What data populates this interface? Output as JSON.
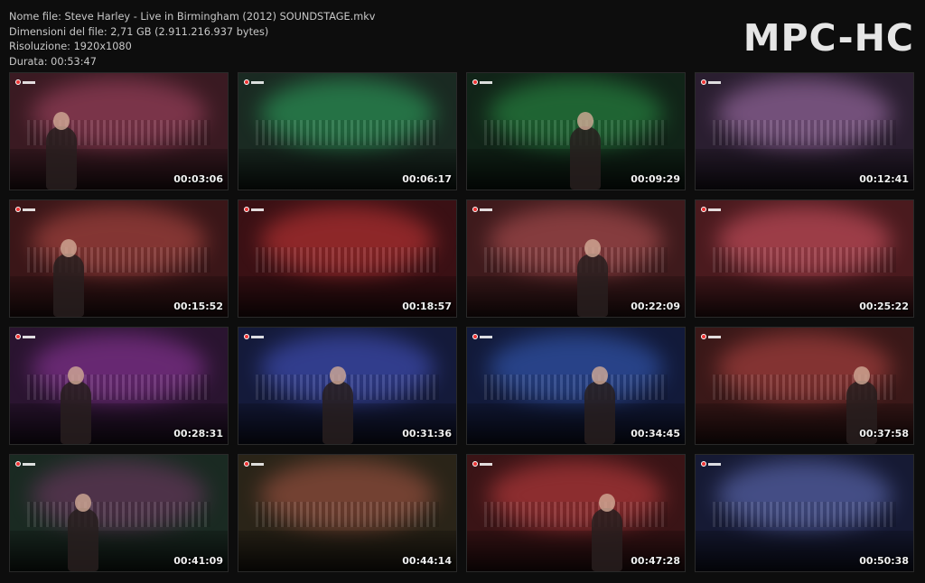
{
  "header": {
    "file_name": "Nome file: Steve Harley - Live in Birmingham (2012) SOUNDSTAGE.mkv",
    "file_size": "Dimensioni del file: 2,71 GB (2.911.216.937 bytes)",
    "resolution": "Risoluzione: 1920x1080",
    "duration": "Durata: 00:53:47"
  },
  "logo": "MPC-HC",
  "thumbnails": [
    {
      "time": "00:03:06",
      "bg": "#3a1a22",
      "glow": "#b04a6a"
    },
    {
      "time": "00:06:17",
      "bg": "#1a2a22",
      "glow": "#2fae63"
    },
    {
      "time": "00:09:29",
      "bg": "#112418",
      "glow": "#2c9a4a"
    },
    {
      "time": "00:12:41",
      "bg": "#2a1e30",
      "glow": "#b07ab8"
    },
    {
      "time": "00:15:52",
      "bg": "#3a1618",
      "glow": "#c0504a"
    },
    {
      "time": "00:18:57",
      "bg": "#3a1014",
      "glow": "#d23a3a"
    },
    {
      "time": "00:22:09",
      "bg": "#3e1a1c",
      "glow": "#c0585a"
    },
    {
      "time": "00:25:22",
      "bg": "#4a1a1e",
      "glow": "#e05a6a"
    },
    {
      "time": "00:28:31",
      "bg": "#2a1430",
      "glow": "#9a3aa8"
    },
    {
      "time": "00:31:36",
      "bg": "#141a3a",
      "glow": "#4a5ad0"
    },
    {
      "time": "00:34:45",
      "bg": "#121a3a",
      "glow": "#3a64c8"
    },
    {
      "time": "00:37:58",
      "bg": "#3a1818",
      "glow": "#c04a48"
    },
    {
      "time": "00:41:09",
      "bg": "#1a2a22",
      "glow": "#7a3a6a"
    },
    {
      "time": "00:44:14",
      "bg": "#2a2418",
      "glow": "#b05a48"
    },
    {
      "time": "00:47:28",
      "bg": "#3a1416",
      "glow": "#d04244"
    },
    {
      "time": "00:50:38",
      "bg": "#161a34",
      "glow": "#6a78c8"
    }
  ]
}
